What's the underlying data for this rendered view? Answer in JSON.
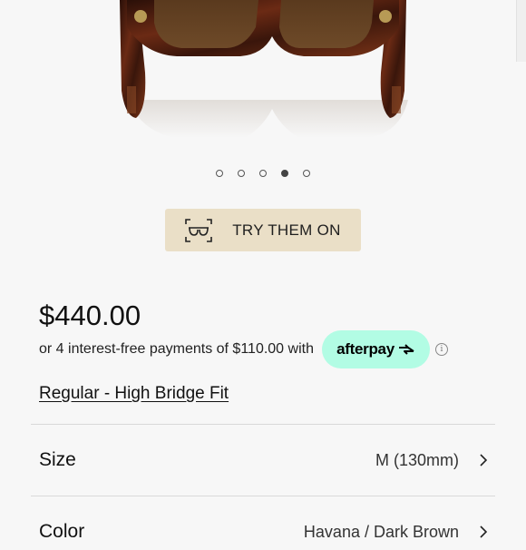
{
  "carousel": {
    "count": 5,
    "active_index": 3
  },
  "try_on": {
    "label": "TRY THEM ON",
    "icon": "glasses-scan-icon"
  },
  "pricing": {
    "price": "$440.00",
    "installment_text": "or 4 interest-free payments of $110.00 with",
    "provider": "afterpay",
    "provider_color": "#b2fce4",
    "info_icon": "info-icon"
  },
  "fit": {
    "label": "Regular - High Bridge Fit"
  },
  "options": [
    {
      "label": "Size",
      "value": "M (130mm)"
    },
    {
      "label": "Color",
      "value": "Havana / Dark Brown"
    }
  ],
  "colors": {
    "accent_button": "#eadfc7"
  }
}
